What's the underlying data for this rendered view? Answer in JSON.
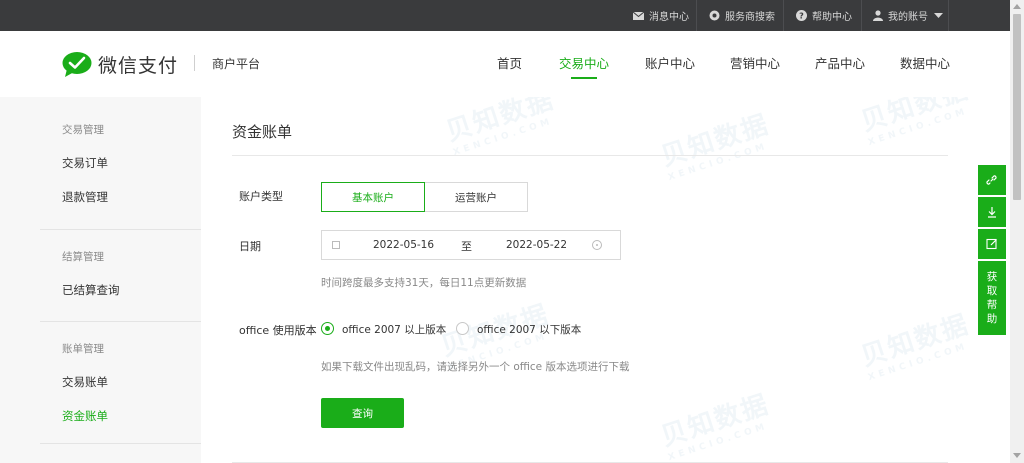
{
  "topbar": {
    "items": [
      {
        "label": "消息中心",
        "icon": "mail-icon"
      },
      {
        "label": "服务商搜索",
        "icon": "search-service-icon"
      },
      {
        "label": "帮助中心",
        "icon": "help-icon"
      },
      {
        "label": "我的账号",
        "icon": "user-icon"
      }
    ]
  },
  "header": {
    "brand": "微信支付",
    "platform": "商户平台",
    "nav": [
      "首页",
      "交易中心",
      "账户中心",
      "营销中心",
      "产品中心",
      "数据中心"
    ],
    "active_nav": "交易中心"
  },
  "sidebar": {
    "groups": [
      {
        "title": "交易管理",
        "items": [
          "交易订单",
          "退款管理"
        ]
      },
      {
        "title": "结算管理",
        "items": [
          "已结算查询"
        ]
      },
      {
        "title": "账单管理",
        "items": [
          "交易账单",
          "资金账单"
        ]
      }
    ],
    "active_item": "资金账单"
  },
  "main": {
    "title": "资金账单",
    "account_type_label": "账户类型",
    "account_tabs": [
      "基本账户",
      "运营账户"
    ],
    "date_label": "日期",
    "date_start": "2022-05-16",
    "date_to": "至",
    "date_end": "2022-05-22",
    "date_hint": "时间跨度最多支持31天，每日11点更新数据",
    "office_label": "office 使用版本",
    "office_options": [
      "office 2007 以上版本",
      "office 2007 以下版本"
    ],
    "office_hint": "如果下载文件出现乱码，请选择另外一个 office 版本选项进行下载",
    "query_button": "查询"
  },
  "right_tools": {
    "icons": [
      "link-icon",
      "download-icon",
      "edit-icon"
    ],
    "help_chars": [
      "获",
      "取",
      "帮",
      "助"
    ]
  },
  "watermark": {
    "text": "贝知数据",
    "sub": "XENCIO.COM"
  },
  "colors": {
    "accent": "#1aad19",
    "topbar": "#3a3b3d",
    "sidebar": "#f7f7f7"
  }
}
